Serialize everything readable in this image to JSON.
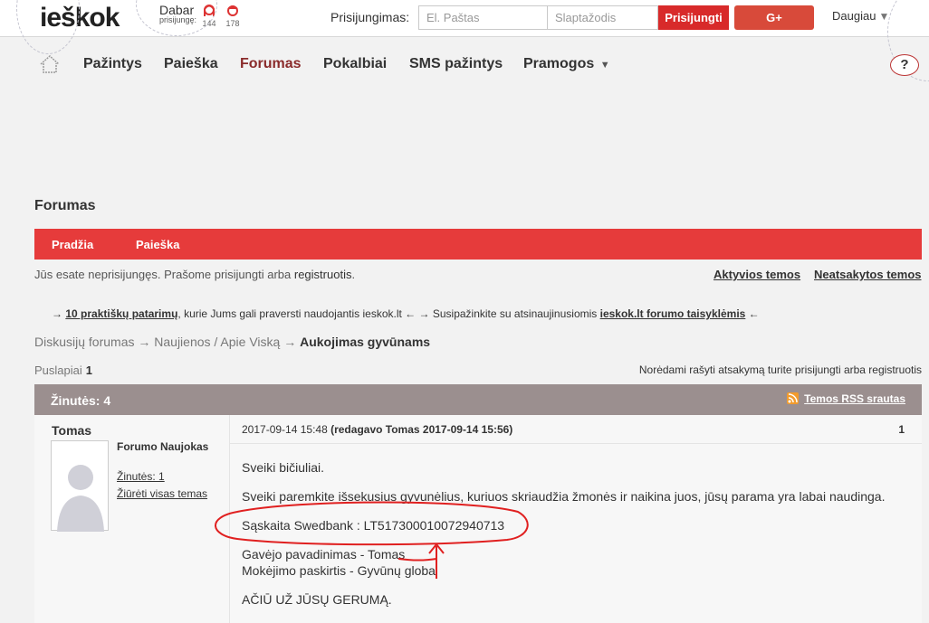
{
  "header": {
    "logo": "ieškok",
    "online": {
      "line1": "Dabar",
      "line2": "prisijungę:",
      "female_count": "144",
      "male_count": "178"
    },
    "login_label": "Prisijungimas:",
    "email_placeholder": "El. Paštas",
    "password_placeholder": "Slaptažodis",
    "login_button": "Prisijungti",
    "gplus_button": "G+",
    "more": "Daugiau"
  },
  "nav": {
    "items": [
      "Pažintys",
      "Paieška",
      "Forumas",
      "Pokalbiai",
      "SMS pažintys",
      "Pramogos"
    ],
    "active": "Forumas",
    "help": "?"
  },
  "forum": {
    "title": "Forumas",
    "menu": [
      "Pradžia",
      "Paieška"
    ],
    "notice_text": "Jūs esate neprisijungęs. Prašome prisijungti arba ",
    "notice_link": "registruotis",
    "notice_end": ".",
    "active_topics": "Aktyvios temos",
    "unanswered_topics": "Neatsakytos temos",
    "tips": {
      "a1": "→ ",
      "link1": "10 praktiškų patarimų",
      "a2": ", kurie Jums gali praversti naudojantis ieskok.lt ← → Susipažinkite su atsinaujinusiomis ",
      "link2": "ieskok.lt forumo taisyklėmis",
      "a3": " ←"
    },
    "breadcrumb": {
      "root": "Diskusijų forumas",
      "sep": " → ",
      "sub": "Naujienos / Apie Viską",
      "current": "Aukojimas gyvūnams"
    },
    "pages_label": "Puslapiai",
    "pages_value": "1",
    "must_login": "Norėdami rašyti atsakymą turite prisijungti arba registruotis",
    "messages_count": "Žinutės: 4",
    "rss": "Temos RSS srautas"
  },
  "post": {
    "author": "Tomas",
    "rank": "Forumo Naujokas",
    "posts_link": "Žinutės: 1",
    "view_topics": "Žiūrėti visas temas",
    "date": "2017-09-14 15:48",
    "edited": "(redagavo Tomas 2017-09-14 15:56)",
    "number": "1",
    "lines": [
      "Sveiki bičiuliai.",
      "Sveiki paremkite išsekusius gyvunėlius, kuriuos skriaudžia žmonės ir naikina juos, jūsų parama yra labai naudinga.",
      "Sąskaita Swedbank : LT517300010072940713",
      "Gavėjo pavadinimas  - Tomas",
      "Mokėjimo paskirtis - Gyvūnų globa",
      "AČIŪ UŽ JŪSŲ GERUMĄ."
    ]
  },
  "colors": {
    "brand_red": "#e63b3b",
    "login_red": "#d82a2a",
    "gplus": "#d84a3a",
    "grey_bar": "#9b8f8f",
    "annotation_red": "#e02020"
  }
}
